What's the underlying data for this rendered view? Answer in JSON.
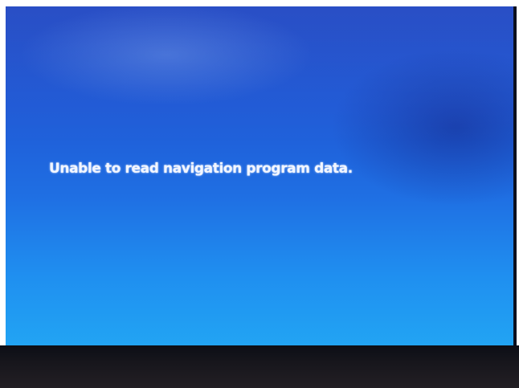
{
  "screen": {
    "message": "Unable to read navigation program data.",
    "background_color": "#1f6fe3",
    "text_color": "#f2f6ff"
  }
}
